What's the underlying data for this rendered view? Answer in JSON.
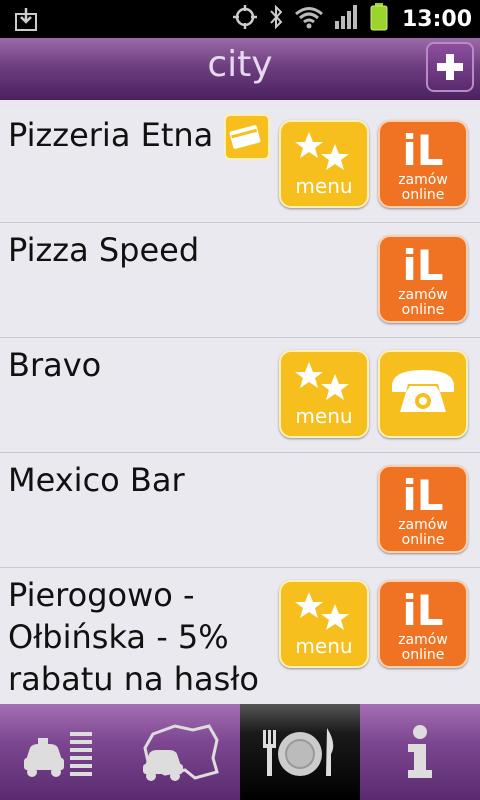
{
  "status_bar": {
    "time": "13:00",
    "icons": [
      "download-icon",
      "gps-icon",
      "bluetooth-icon",
      "wifi-icon",
      "signal-icon",
      "battery-icon"
    ]
  },
  "header": {
    "title": "city",
    "add_icon": "plus-icon"
  },
  "restaurants": [
    {
      "name": "Pizzeria Etna",
      "card_badge": true,
      "menu": true,
      "order": true,
      "phone": false
    },
    {
      "name": "Pizza Speed",
      "card_badge": false,
      "menu": false,
      "order": true,
      "phone": false
    },
    {
      "name": "Bravo",
      "card_badge": false,
      "menu": true,
      "order": false,
      "phone": true
    },
    {
      "name": "Mexico Bar",
      "card_badge": false,
      "menu": false,
      "order": true,
      "phone": false
    },
    {
      "name": "Pierogowo - Ołbińska - 5% rabatu na hasło",
      "card_badge": false,
      "menu": true,
      "order": true,
      "phone": false
    }
  ],
  "tiles": {
    "menu_label": "menu",
    "order_logo": "iL",
    "order_label_line1": "zamów",
    "order_label_line2": "online"
  },
  "bottom_nav": {
    "items": [
      "taxi-list-icon",
      "taxi-map-icon",
      "restaurant-plate-icon",
      "info-icon"
    ],
    "active_index": 2
  },
  "colors": {
    "purple_accent": "#6e3f80",
    "menu_tile": "#f7bf1e",
    "order_tile": "#ef7322",
    "list_bg": "#e9e9ef"
  }
}
